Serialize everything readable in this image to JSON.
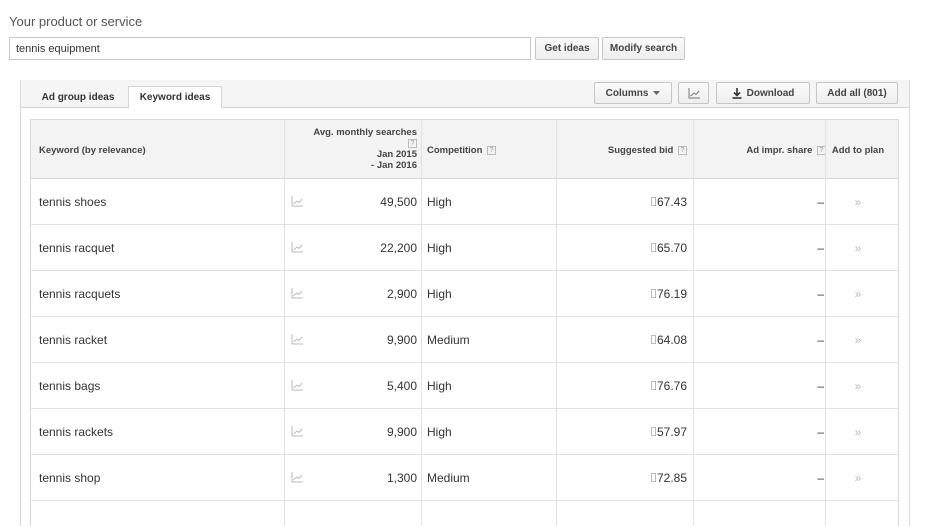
{
  "search": {
    "label": "Your product or service",
    "value": "tennis equipment",
    "get_ideas": "Get ideas",
    "modify_search": "Modify search"
  },
  "tabs": [
    {
      "label": "Ad group ideas"
    },
    {
      "label": "Keyword ideas"
    }
  ],
  "toolbar": {
    "columns": "Columns",
    "download": "Download",
    "add_all": "Add all (801)"
  },
  "table": {
    "headers": {
      "keyword": "Keyword (by relevance)",
      "avg_line1": "Avg. monthly searches",
      "avg_line2": "Jan 2015",
      "avg_line3": "- Jan 2016",
      "competition": "Competition",
      "suggested_bid": "Suggested bid",
      "ad_share": "Ad impr. share",
      "add_to_plan": "Add to plan"
    },
    "rows": [
      {
        "keyword": "tennis shoes",
        "avg": "49,500",
        "competition": "High",
        "bid": "67.43",
        "share": "–",
        "add": "»"
      },
      {
        "keyword": "tennis racquet",
        "avg": "22,200",
        "competition": "High",
        "bid": "65.70",
        "share": "–",
        "add": "»"
      },
      {
        "keyword": "tennis racquets",
        "avg": "2,900",
        "competition": "High",
        "bid": "76.19",
        "share": "–",
        "add": "»"
      },
      {
        "keyword": "tennis racket",
        "avg": "9,900",
        "competition": "Medium",
        "bid": "64.08",
        "share": "–",
        "add": "»"
      },
      {
        "keyword": "tennis bags",
        "avg": "5,400",
        "competition": "High",
        "bid": "76.76",
        "share": "–",
        "add": "»"
      },
      {
        "keyword": "tennis rackets",
        "avg": "9,900",
        "competition": "High",
        "bid": "57.97",
        "share": "–",
        "add": "»"
      },
      {
        "keyword": "tennis shop",
        "avg": "1,300",
        "competition": "Medium",
        "bid": "72.85",
        "share": "–",
        "add": "»"
      }
    ]
  },
  "icons": {
    "trend": "line-chart-icon",
    "download": "download-icon",
    "dropdown": "caret-down-icon",
    "help": "question-mark-icon",
    "add": "double-chevron-right-icon"
  },
  "colors": {
    "header_bg": "#f3f3f3",
    "border": "#d8d8d8",
    "muted_icon": "#bbbbbb"
  }
}
